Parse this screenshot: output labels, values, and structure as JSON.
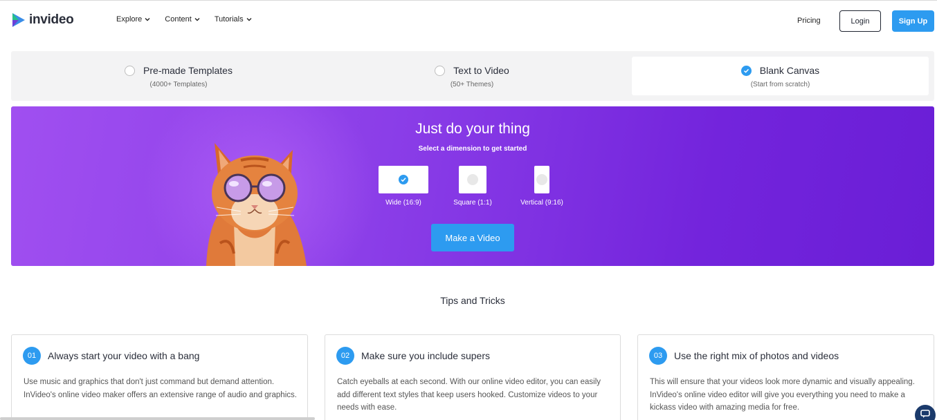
{
  "header": {
    "logo_text": "invideo",
    "nav": [
      {
        "label": "Explore"
      },
      {
        "label": "Content"
      },
      {
        "label": "Tutorials"
      }
    ],
    "pricing": "Pricing",
    "login": "Login",
    "signup": "Sign Up"
  },
  "modes": [
    {
      "title": "Pre-made Templates",
      "sub": "(4000+ Templates)",
      "selected": false
    },
    {
      "title": "Text to Video",
      "sub": "(50+ Themes)",
      "selected": false
    },
    {
      "title": "Blank Canvas",
      "sub": "(Start from scratch)",
      "selected": true
    }
  ],
  "hero": {
    "title": "Just do your thing",
    "subtitle": "Select a dimension to get started",
    "dimensions": [
      {
        "label": "Wide (16:9)",
        "selected": true
      },
      {
        "label": "Square (1:1)",
        "selected": false
      },
      {
        "label": "Vertical (9:16)",
        "selected": false
      }
    ],
    "cta": "Make a Video"
  },
  "tips": {
    "title": "Tips and Tricks",
    "cards": [
      {
        "num": "01",
        "title": "Always start your video with a bang",
        "body": "Use music and graphics that don't just command but demand attention. InVideo's online video maker offers an extensive range of audio and graphics."
      },
      {
        "num": "02",
        "title": "Make sure you include supers",
        "body": "Catch eyeballs at each second. With our online video editor, you can easily add different text styles that keep users hooked. Customize videos to your needs with ease."
      },
      {
        "num": "03",
        "title": "Use the right mix of photos and videos",
        "body": "This will ensure that your videos look more dynamic and visually appealing. InVideo's online video editor will give you everything you need to make a kickass video with amazing media for free."
      }
    ]
  },
  "colors": {
    "accent": "#2d9bf0",
    "hero_start": "#a04ff0",
    "hero_end": "#6a1ed6",
    "chat": "#1b3a6b"
  }
}
